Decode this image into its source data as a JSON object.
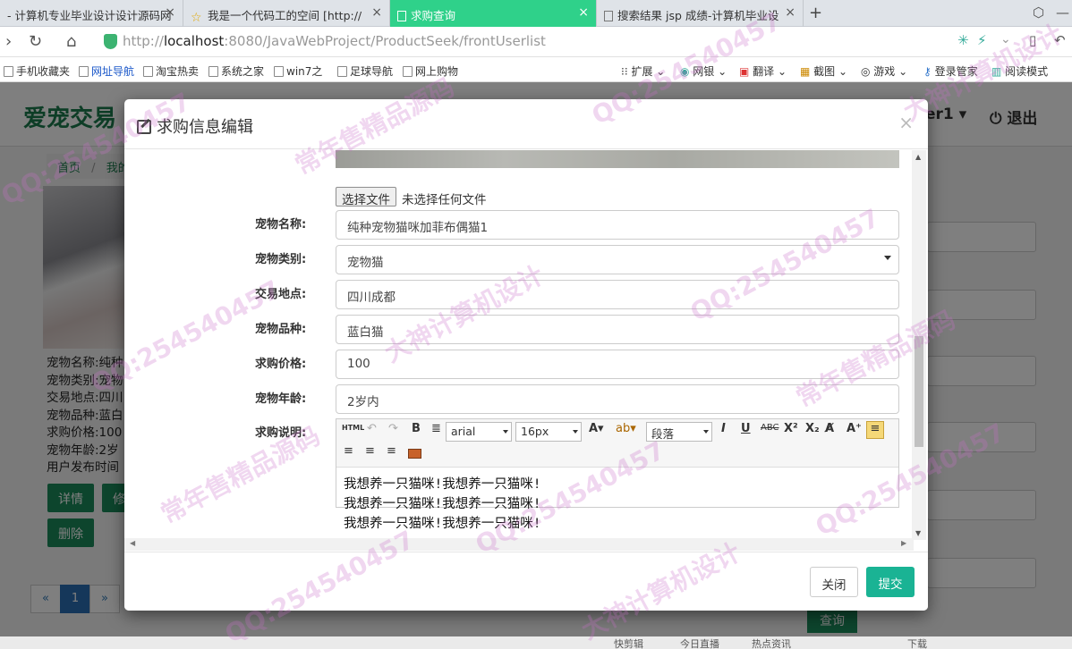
{
  "browser": {
    "tabs": [
      {
        "label": "- 计算机专业毕业设计设计源码网",
        "active": false
      },
      {
        "label": "我是一个代码工的空间 [http://",
        "active": false
      },
      {
        "label": "求购查询",
        "active": true
      },
      {
        "label": "搜索结果 jsp 成绩-计算机毕业设",
        "active": false
      }
    ],
    "url_prefix": "http://",
    "url_host": "localhost",
    "url_rest": ":8080/JavaWebProject/ProductSeek/frontUserlist",
    "bookmarks": [
      "手机收藏夹",
      "网址导航",
      "淘宝热卖",
      "系统之家",
      "win7之",
      "足球导航",
      "网上购物"
    ],
    "toolbar_right": [
      "扩展",
      "网银",
      "翻译",
      "截图",
      "游戏",
      "登录管家",
      "阅读模式"
    ]
  },
  "page": {
    "brand": "爱宠交易",
    "user": "er1",
    "logout": "退出",
    "breadcrumb": [
      "首页",
      "我的"
    ],
    "pet_info": [
      "宠物名称:纯种",
      "宠物类别:宠物",
      "交易地点:四川",
      "宠物品种:蓝白",
      "求购价格:100",
      "宠物年龄:2岁",
      "用户发布时间"
    ],
    "buttons": {
      "detail": "详情",
      "modify": "修",
      "delete": "删除",
      "search": "查询"
    },
    "pager": {
      "prev": "«",
      "current": "1",
      "next": "»"
    }
  },
  "modal": {
    "title": "求购信息编辑",
    "close_symbol": "×",
    "file": {
      "button": "选择文件",
      "status": "未选择任何文件"
    },
    "fields": [
      {
        "label": "宠物名称:",
        "value": "纯种宠物猫咪加菲布偶猫1",
        "type": "text"
      },
      {
        "label": "宠物类别:",
        "value": "宠物猫",
        "type": "select"
      },
      {
        "label": "交易地点:",
        "value": "四川成都",
        "type": "text"
      },
      {
        "label": "宠物品种:",
        "value": "蓝白猫",
        "type": "text"
      },
      {
        "label": "求购价格:",
        "value": "100",
        "type": "text"
      },
      {
        "label": "宠物年龄:",
        "value": "2岁内",
        "type": "text"
      }
    ],
    "description_label": "求购说明:",
    "editor": {
      "html_btn": "HTML",
      "font_family": "arial",
      "font_size": "16px",
      "paragraph": "段落",
      "lines": [
        "我想养一只猫咪!我想养一只猫咪!",
        "我想养一只猫咪!我想养一只猫咪!",
        "我想养一只猫咪!我想养一只猫咪!"
      ]
    },
    "footer": {
      "close": "关闭",
      "submit": "提交"
    }
  },
  "statusbar": [
    "快剪辑",
    "今日直播",
    "热点资讯",
    "下载"
  ],
  "watermarks": [
    "QQ:254540457",
    "常年售精品源码",
    "大神计算机设计"
  ],
  "colors": {
    "active_tab": "#2fd18a",
    "brand": "#1a7a4c",
    "submit": "#1ab394",
    "page_button": "#1a8a5a"
  }
}
